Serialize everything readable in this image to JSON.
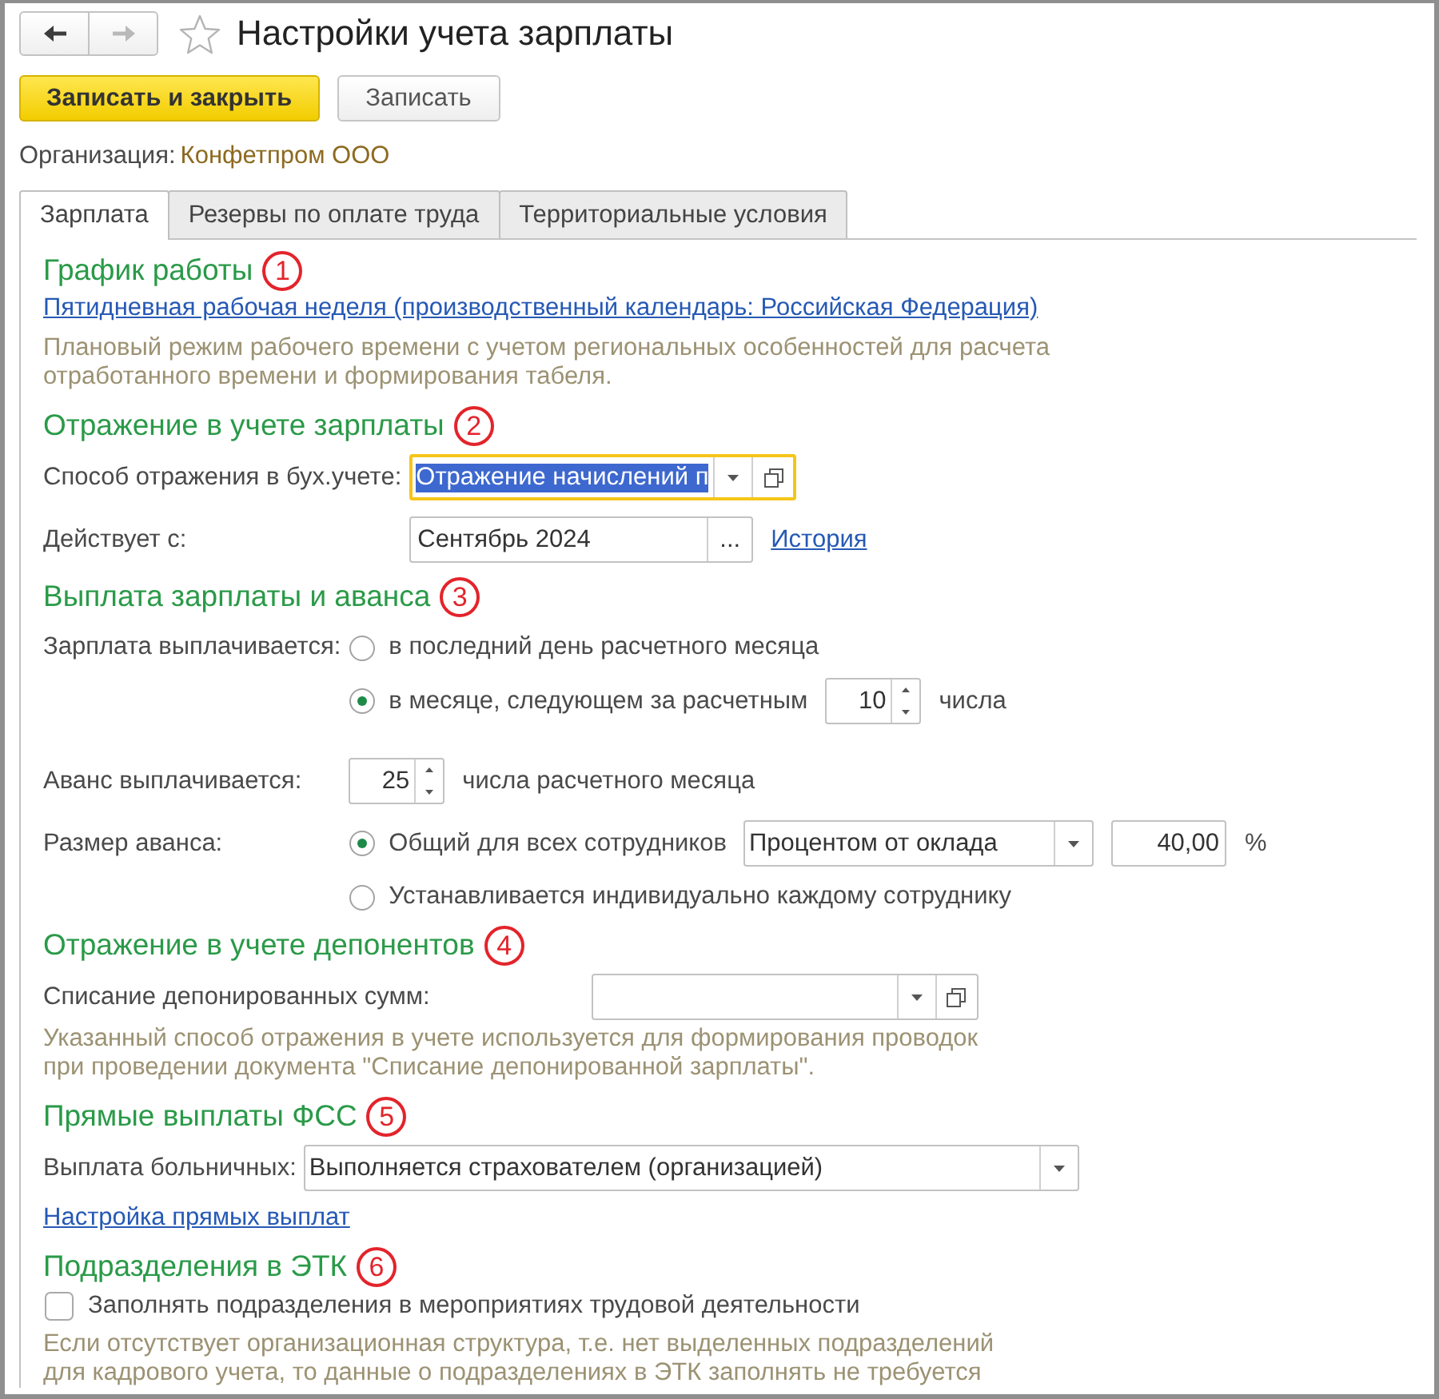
{
  "window": {
    "title": "Настройки учета зарплаты",
    "favorite": false
  },
  "nav": [
    {
      "kind": "back",
      "disabled": false
    },
    {
      "kind": "forward",
      "disabled": true
    }
  ],
  "toolbar": [
    {
      "label": "Записать и закрыть",
      "default": true
    },
    {
      "label": "Записать",
      "default": false
    }
  ],
  "organization": {
    "label": "Организация:",
    "value": "Конфетпром ООО"
  },
  "tabs": [
    {
      "label": "Зарплата",
      "selected": true
    },
    {
      "label": "Резервы по оплате труда",
      "selected": false
    },
    {
      "label": "Территориальные условия",
      "selected": false
    }
  ],
  "sections": [
    {
      "title": "График работы",
      "marker": "1",
      "rows": [
        {
          "kind": "link",
          "text": "Пятидневная рабочая неделя (производственный календарь: Российская Федерация)"
        },
        {
          "kind": "note",
          "text": "Плановый режим рабочего времени с учетом региональных особенностей для расчета\nотработанного времени и формирования табеля."
        }
      ]
    },
    {
      "title": "Отражение в учете зарплаты",
      "marker": "2",
      "rows": [
        {
          "kind": "field",
          "label": "Способ отражения в бух.учете:",
          "controls": [
            {
              "kind": "combo",
              "value": "Отражение начислений п",
              "focused": true,
              "text_selected": true,
              "open_button": true
            }
          ]
        },
        {
          "kind": "field",
          "label": "Действует с:",
          "controls": [
            {
              "kind": "input",
              "value": "Сентябрь 2024",
              "choice_button": "..."
            },
            {
              "kind": "link",
              "text": "История"
            }
          ]
        }
      ]
    },
    {
      "title": "Выплата зарплаты и аванса",
      "marker": "3",
      "rows": [
        {
          "kind": "radio_group",
          "label": "Зарплата выплачивается:",
          "options": [
            {
              "label": "в последний день расчетного месяца",
              "selected": false
            },
            {
              "label": "в месяце, следующем за расчетным",
              "selected": true,
              "controls": [
                {
                  "kind": "spinner",
                  "value": "10"
                },
                {
                  "kind": "text",
                  "text": "числа"
                }
              ]
            }
          ]
        },
        {
          "kind": "field",
          "label": "Аванс выплачивается:",
          "controls": [
            {
              "kind": "spinner",
              "value": "25"
            },
            {
              "kind": "text",
              "text": "числа расчетного месяца"
            }
          ]
        },
        {
          "kind": "radio_group",
          "label": "Размер аванса:",
          "options": [
            {
              "label": "Общий для всех сотрудников",
              "selected": true,
              "controls": [
                {
                  "kind": "combo",
                  "value": "Процентом от оклада",
                  "focused": false
                },
                {
                  "kind": "number",
                  "value": "40,00"
                },
                {
                  "kind": "text",
                  "text": "%"
                }
              ]
            },
            {
              "label": "Устанавливается индивидуально каждому сотруднику",
              "selected": false
            }
          ]
        }
      ]
    },
    {
      "title": "Отражение в учете депонентов",
      "marker": "4",
      "rows": [
        {
          "kind": "field",
          "label": "Списание депонированных сумм:",
          "controls": [
            {
              "kind": "combo",
              "focused": false,
              "open_button": true
            }
          ]
        },
        {
          "kind": "note",
          "text": "Указанный способ отражения в учете используется для формирования проводок\nпри проведении документа \"Списание депонированной зарплаты\"."
        }
      ]
    },
    {
      "title": "Прямые выплаты ФСС",
      "marker": "5",
      "rows": [
        {
          "kind": "field",
          "label": "Выплата больничных:",
          "controls": [
            {
              "kind": "combo",
              "value": "Выполняется страхователем (организацией)",
              "focused": false
            }
          ]
        },
        {
          "kind": "link",
          "text": "Настройка прямых выплат"
        }
      ]
    },
    {
      "title": "Подразделения в ЭТК",
      "marker": "6",
      "rows": [
        {
          "kind": "checkbox",
          "label": "Заполнять подразделения в мероприятиях трудовой деятельности",
          "checked": false
        },
        {
          "kind": "note",
          "text": "Если отсутствует организационная структура, т.е. нет выделенных подразделений\nдля кадрового учета, то данные о подразделениях в ЭТК заполнять не требуется"
        }
      ]
    }
  ]
}
